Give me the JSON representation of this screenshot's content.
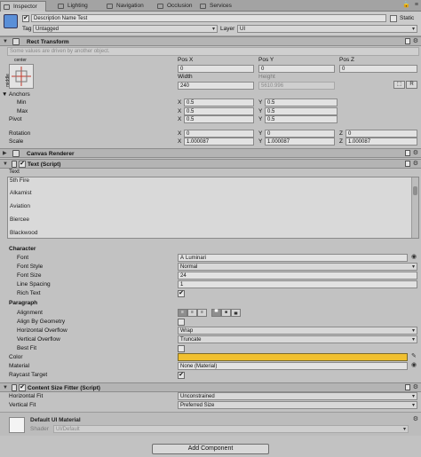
{
  "tabs": [
    {
      "label": "Inspector",
      "active": true
    },
    {
      "label": "Lighting"
    },
    {
      "label": "Navigation"
    },
    {
      "label": "Occlusion"
    },
    {
      "label": "Services"
    }
  ],
  "object": {
    "name": "Description Name Test",
    "static_label": "Static",
    "tag_label": "Tag",
    "tag_value": "Untagged",
    "layer_label": "Layer",
    "layer_value": "UI"
  },
  "rect_transform": {
    "title": "Rect Transform",
    "notice": "Some values are driven by another object.",
    "anchor_top": "center",
    "anchor_side": "middle",
    "pos_x_label": "Pos X",
    "pos_y_label": "Pos Y",
    "pos_z_label": "Pos Z",
    "pos_x": "0",
    "pos_y": "0",
    "pos_z": "0",
    "width_label": "Width",
    "height_label": "Height",
    "width": "240",
    "height": "5610.996",
    "r_button": "R",
    "anchors_label": "Anchors",
    "min_label": "Min",
    "max_label": "Max",
    "pivot_label": "Pivot",
    "min_x": "0.5",
    "min_y": "0.5",
    "max_x": "0.5",
    "max_y": "0.5",
    "pivot_x": "0.5",
    "pivot_y": "0.5",
    "rotation_label": "Rotation",
    "scale_label": "Scale",
    "rot_x": "0",
    "rot_y": "0",
    "rot_z": "0",
    "scale_x": "1.000087",
    "scale_y": "1.000087",
    "scale_z": "1.000087",
    "x": "X",
    "y": "Y",
    "z": "Z"
  },
  "canvas_renderer": {
    "title": "Canvas Renderer"
  },
  "text_script": {
    "title": "Text (Script)",
    "text_label": "Text",
    "text_lines": [
      "5th Fire",
      "Alkamist",
      "Aviation",
      "Biercee",
      "Blackwood"
    ],
    "character_label": "Character",
    "font_label": "Font",
    "font_value": "Luminari",
    "font_style_label": "Font Style",
    "font_style_value": "Normal",
    "font_size_label": "Font Size",
    "font_size_value": "24",
    "line_spacing_label": "Line Spacing",
    "line_spacing_value": "1",
    "rich_text_label": "Rich Text",
    "paragraph_label": "Paragraph",
    "alignment_label": "Alignment",
    "align_by_geometry_label": "Align By Geometry",
    "horizontal_overflow_label": "Horizontal Overflow",
    "horizontal_overflow_value": "Wrap",
    "vertical_overflow_label": "Vertical Overflow",
    "vertical_overflow_value": "Truncate",
    "best_fit_label": "Best Fit",
    "color_label": "Color",
    "color_value": "#f0c030",
    "material_label": "Material",
    "material_value": "None (Material)",
    "raycast_label": "Raycast Target"
  },
  "content_size_fitter": {
    "title": "Content Size Fitter (Script)",
    "horizontal_fit_label": "Horizontal Fit",
    "horizontal_fit_value": "Unconstrained",
    "vertical_fit_label": "Vertical Fit",
    "vertical_fit_value": "Preferred Size"
  },
  "material": {
    "name": "Default UI Material",
    "shader_label": "Shader",
    "shader_value": "UI/Default"
  },
  "add_component_label": "Add Component",
  "colors": {
    "panel": "#c2c2c2",
    "accent_color_swatch": "#f0c030"
  }
}
